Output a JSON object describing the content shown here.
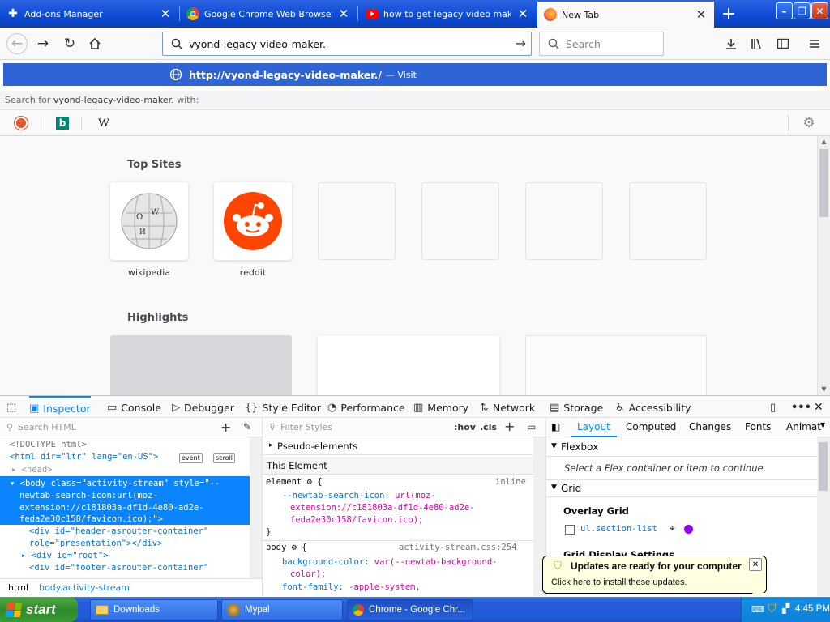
{
  "tabs": [
    {
      "label": "Add-ons Manager",
      "icon": "puzzle-icon"
    },
    {
      "label": "Google Chrome Web Browser",
      "icon": "chrome-icon"
    },
    {
      "label": "how to get legacy video maker ba",
      "icon": "youtube-icon"
    },
    {
      "label": "New Tab",
      "icon": "firefox-icon"
    }
  ],
  "navbar": {
    "url_value": "vyond-legacy-video-maker.",
    "search_placeholder": "Search"
  },
  "dropdown": {
    "url": "http://vyond-legacy-video-maker./",
    "suffix": "— Visit",
    "search_for_prefix": "Search for",
    "search_for_term": "vyond-legacy-video-maker.",
    "search_for_suffix": "with:",
    "engines": [
      "duckduckgo-icon",
      "bing-icon",
      "wikipedia-icon"
    ]
  },
  "newtab": {
    "top_sites_title": "Top Sites",
    "sites": [
      {
        "label": "wikipedia"
      },
      {
        "label": "reddit"
      }
    ],
    "highlights_title": "Highlights"
  },
  "devtools": {
    "tabs": [
      "Inspector",
      "Console",
      "Debugger",
      "Style Editor",
      "Performance",
      "Memory",
      "Network",
      "Storage",
      "Accessibility"
    ],
    "search_html_placeholder": "Search HTML",
    "filter_styles_placeholder": "Filter Styles",
    "hov": ":hov",
    "cls": ".cls",
    "html_lines": [
      "<!DOCTYPE html>",
      "<html dir=\"ltr\" lang=\"en-US\">",
      "<head>",
      "<body class=\"activity-stream\" style=\"--",
      "newtab-search-icon:url(moz-",
      "extension://c181803a-df1d-4e80-ad2e-",
      "feda2e30c158/favicon.ico);\">",
      "<div id=\"header-asrouter-container\"",
      "role=\"presentation\"></div>",
      "<div id=\"root\">",
      "<div id=\"footer-asrouter-container\""
    ],
    "badges": [
      "event",
      "scroll"
    ],
    "breadcrumbs": [
      "html",
      "body.activity-stream"
    ],
    "rules": {
      "pseudo": "Pseudo-elements",
      "this_element": "This Element",
      "element_selector": "element",
      "element_source": "inline",
      "element_prop": "--newtab-search-icon:",
      "element_val1": "url(moz-",
      "element_val2": "extension://c181803a-df1d-4e80-ad2e-",
      "element_val3": "feda2e30c158/favicon.ico);",
      "body_selector": "body",
      "body_source": "activity-stream.css:254",
      "body_prop1": "background-color:",
      "body_val1": "var(--newtab-background-",
      "body_val1b": "color);",
      "body_prop2": "font-family:",
      "body_val2": "-apple-system,"
    },
    "right_tabs": [
      "Layout",
      "Computed",
      "Changes",
      "Fonts",
      "Animat"
    ],
    "flexbox_title": "Flexbox",
    "flexbox_hint": "Select a Flex container or item to continue.",
    "grid_title": "Grid",
    "overlay_grid": "Overlay Grid",
    "grid_item": "ul.section-list",
    "grid_display": "Grid Display Settings"
  },
  "notification": {
    "title": "Updates are ready for your computer",
    "body": "Click here to install these updates."
  },
  "taskbar": {
    "start": "start",
    "items": [
      "Downloads",
      "Mypal",
      "Chrome - Google Chr..."
    ],
    "time": "4:45 PM"
  },
  "colors": {
    "accent": "#0a84ff",
    "url_highlight": "#2f64d6",
    "xp_blue": "#245edb",
    "start_green": "#3a9b34"
  }
}
